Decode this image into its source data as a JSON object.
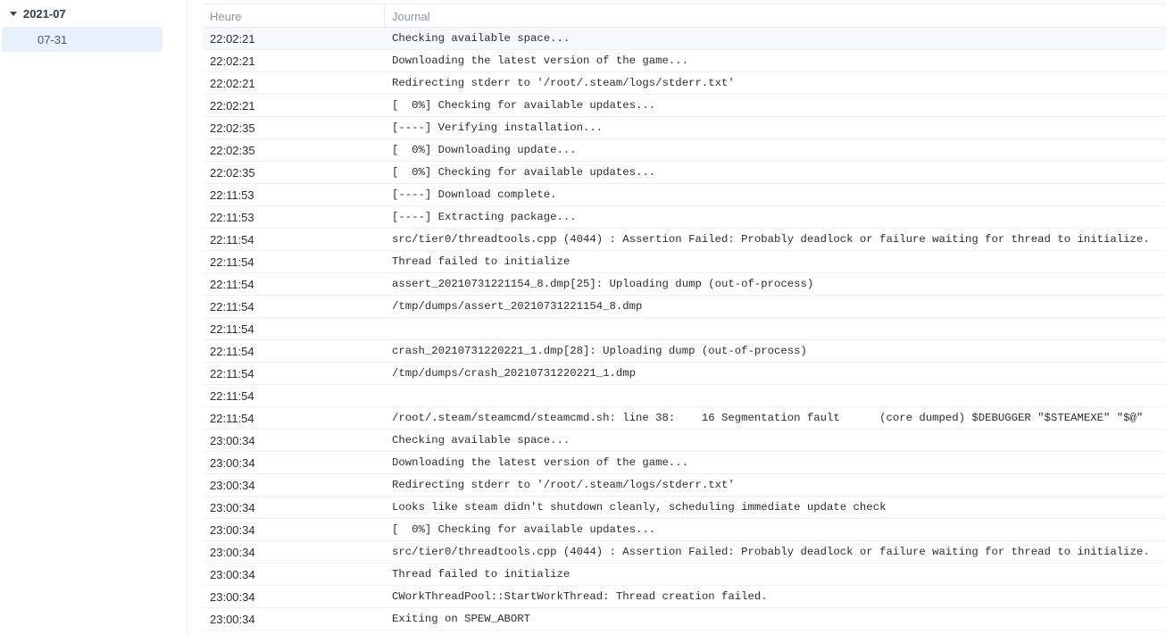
{
  "sidebar": {
    "group_label": "2021-07",
    "item_label": "07-31"
  },
  "table": {
    "col_time": "Heure",
    "col_message": "Journal",
    "rows": [
      {
        "time": "22:02:21",
        "msg": "Checking available space..."
      },
      {
        "time": "22:02:21",
        "msg": "Downloading the latest version of the game..."
      },
      {
        "time": "22:02:21",
        "msg": "Redirecting stderr to '/root/.steam/logs/stderr.txt'"
      },
      {
        "time": "22:02:21",
        "msg": "[  0%] Checking for available updates..."
      },
      {
        "time": "22:02:35",
        "msg": "[----] Verifying installation..."
      },
      {
        "time": "22:02:35",
        "msg": "[  0%] Downloading update..."
      },
      {
        "time": "22:02:35",
        "msg": "[  0%] Checking for available updates..."
      },
      {
        "time": "22:11:53",
        "msg": "[----] Download complete."
      },
      {
        "time": "22:11:53",
        "msg": "[----] Extracting package..."
      },
      {
        "time": "22:11:54",
        "msg": "src/tier0/threadtools.cpp (4044) : Assertion Failed: Probably deadlock or failure waiting for thread to initialize."
      },
      {
        "time": "22:11:54",
        "msg": "Thread failed to initialize"
      },
      {
        "time": "22:11:54",
        "msg": "assert_20210731221154_8.dmp[25]: Uploading dump (out-of-process)"
      },
      {
        "time": "22:11:54",
        "msg": "/tmp/dumps/assert_20210731221154_8.dmp"
      },
      {
        "time": "22:11:54",
        "msg": ""
      },
      {
        "time": "22:11:54",
        "msg": "crash_20210731220221_1.dmp[28]: Uploading dump (out-of-process)"
      },
      {
        "time": "22:11:54",
        "msg": "/tmp/dumps/crash_20210731220221_1.dmp"
      },
      {
        "time": "22:11:54",
        "msg": ""
      },
      {
        "time": "22:11:54",
        "msg": "/root/.steam/steamcmd/steamcmd.sh: line 38:    16 Segmentation fault      (core dumped) $DEBUGGER \"$STEAMEXE\" \"$@\""
      },
      {
        "time": "23:00:34",
        "msg": "Checking available space..."
      },
      {
        "time": "23:00:34",
        "msg": "Downloading the latest version of the game..."
      },
      {
        "time": "23:00:34",
        "msg": "Redirecting stderr to '/root/.steam/logs/stderr.txt'"
      },
      {
        "time": "23:00:34",
        "msg": "Looks like steam didn't shutdown cleanly, scheduling immediate update check"
      },
      {
        "time": "23:00:34",
        "msg": "[  0%] Checking for available updates..."
      },
      {
        "time": "23:00:34",
        "msg": "src/tier0/threadtools.cpp (4044) : Assertion Failed: Probably deadlock or failure waiting for thread to initialize."
      },
      {
        "time": "23:00:34",
        "msg": "Thread failed to initialize"
      },
      {
        "time": "23:00:34",
        "msg": "CWorkThreadPool::StartWorkThread: Thread creation failed."
      },
      {
        "time": "23:00:34",
        "msg": "Exiting on SPEW_ABORT"
      }
    ]
  }
}
